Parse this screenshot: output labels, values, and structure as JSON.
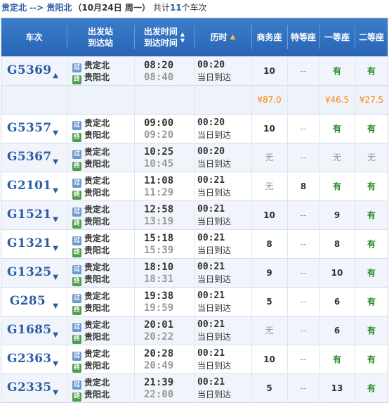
{
  "summary": {
    "route": "贵定北 --> 贵阳北",
    "date": "（10月24日  周一）",
    "count_prefix": "共计",
    "count": "11",
    "count_suffix": "个车次"
  },
  "headers": {
    "train": "车次",
    "station_top": "出发站",
    "station_bottom": "到达站",
    "time_top": "出发时间",
    "time_bottom": "到达时间",
    "duration": "历时",
    "business": "商务座",
    "premium": "特等座",
    "first": "一等座",
    "second": "二等座"
  },
  "price_row": {
    "business": "¥87.0",
    "premium": "",
    "first": "¥46.5",
    "second": "¥27.5"
  },
  "trains": [
    {
      "no": "G5369",
      "expanded": true,
      "from": "贵定北",
      "to": "贵阳北",
      "dep": "08:20",
      "arr": "08:40",
      "dur": "00:20",
      "note": "当日到达",
      "business": "10",
      "premium": "--",
      "first": "有",
      "second": "有"
    },
    {
      "no": "G5357",
      "from": "贵定北",
      "to": "贵阳北",
      "dep": "09:00",
      "arr": "09:20",
      "dur": "00:20",
      "note": "当日到达",
      "business": "10",
      "premium": "--",
      "first": "有",
      "second": "有"
    },
    {
      "no": "G5367",
      "from": "贵定北",
      "to": "贵阳北",
      "dep": "10:25",
      "arr": "10:45",
      "dur": "00:20",
      "note": "当日到达",
      "business": "无",
      "premium": "--",
      "first": "无",
      "second": "无"
    },
    {
      "no": "G2101",
      "from": "贵定北",
      "to": "贵阳北",
      "dep": "11:08",
      "arr": "11:29",
      "dur": "00:21",
      "note": "当日到达",
      "business": "无",
      "premium": "8",
      "first": "有",
      "second": "有"
    },
    {
      "no": "G1521",
      "from": "贵定北",
      "to": "贵阳北",
      "dep": "12:58",
      "arr": "13:19",
      "dur": "00:21",
      "note": "当日到达",
      "business": "10",
      "premium": "--",
      "first": "9",
      "second": "有"
    },
    {
      "no": "G1321",
      "from": "贵定北",
      "to": "贵阳北",
      "dep": "15:18",
      "arr": "15:39",
      "dur": "00:21",
      "note": "当日到达",
      "business": "8",
      "premium": "--",
      "first": "8",
      "second": "有"
    },
    {
      "no": "G1325",
      "from": "贵定北",
      "to": "贵阳北",
      "dep": "18:10",
      "arr": "18:31",
      "dur": "00:21",
      "note": "当日到达",
      "business": "9",
      "premium": "--",
      "first": "10",
      "second": "有"
    },
    {
      "no": "G285",
      "from": "贵定北",
      "to": "贵阳北",
      "dep": "19:38",
      "arr": "19:59",
      "dur": "00:21",
      "note": "当日到达",
      "business": "5",
      "premium": "--",
      "first": "6",
      "second": "有"
    },
    {
      "no": "G1685",
      "from": "贵定北",
      "to": "贵阳北",
      "dep": "20:01",
      "arr": "20:22",
      "dur": "00:21",
      "note": "当日到达",
      "business": "无",
      "premium": "--",
      "first": "6",
      "second": "有"
    },
    {
      "no": "G2363",
      "from": "贵定北",
      "to": "贵阳北",
      "dep": "20:28",
      "arr": "20:49",
      "dur": "00:21",
      "note": "当日到达",
      "business": "10",
      "premium": "--",
      "first": "有",
      "second": "有"
    },
    {
      "no": "G2335",
      "from": "贵定北",
      "to": "贵阳北",
      "dep": "21:39",
      "arr": "22:00",
      "dur": "00:21",
      "note": "当日到达",
      "business": "5",
      "premium": "--",
      "first": "13",
      "second": "有"
    }
  ],
  "icons": {
    "pass": "过",
    "end": "终"
  },
  "colors": {
    "header_bg": "#2d6cbd",
    "train_no": "#2b5da3",
    "available": "#2a8a2a",
    "price": "#ff8400",
    "sort_active": "#ffb54d"
  }
}
